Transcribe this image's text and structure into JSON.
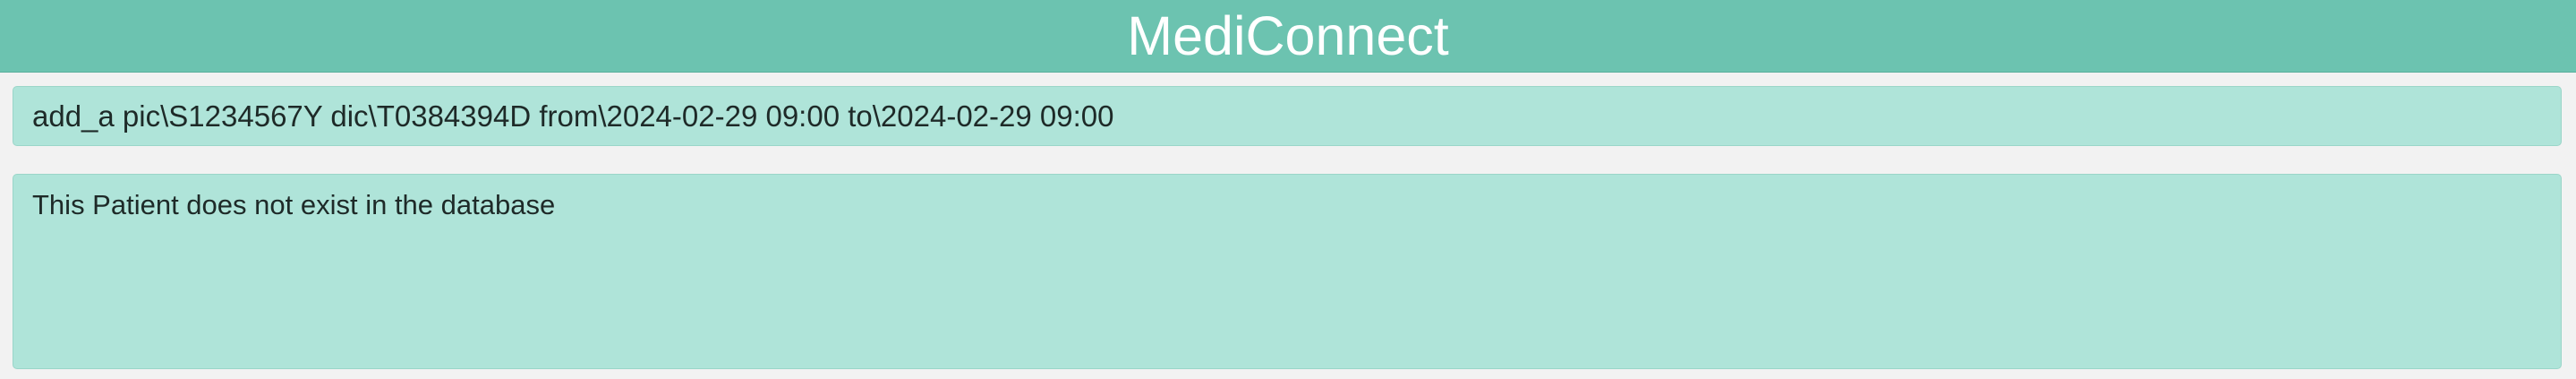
{
  "app": {
    "title": "MediConnect"
  },
  "command_box": {
    "value": "add_a pic\\S1234567Y dic\\T0384394D from\\2024-02-29 09:00 to\\2024-02-29 09:00"
  },
  "result_display": {
    "message": "This Patient does not exist in the database"
  },
  "colors": {
    "title_bar": "#6cc3b0",
    "box_background": "#afe4d9",
    "page_background": "#f2f2f2"
  }
}
